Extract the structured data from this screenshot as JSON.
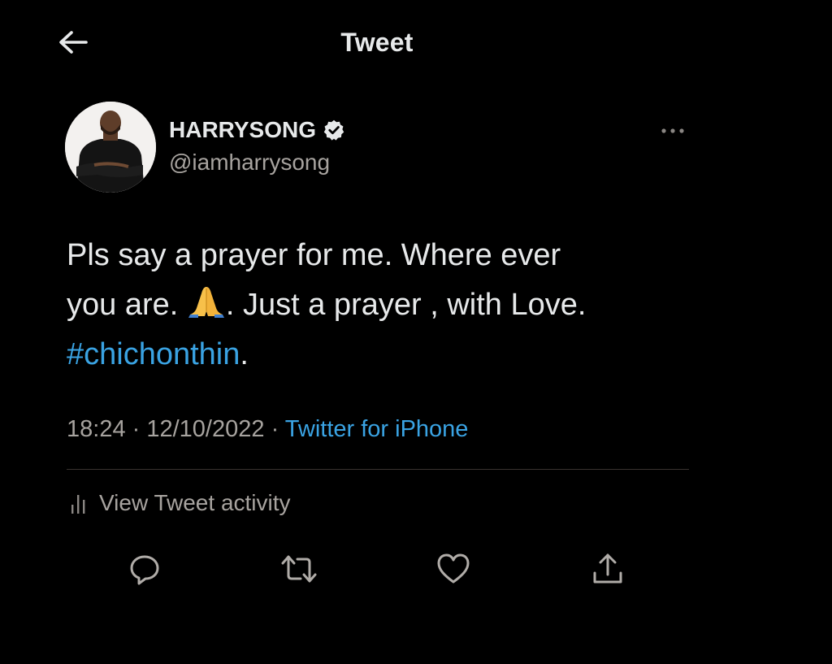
{
  "header": {
    "title": "Tweet",
    "back_icon": "arrow-left-icon"
  },
  "author": {
    "display_name": "HARRYSONG",
    "handle": "@iamharrysong",
    "verified_icon": "verified-badge-icon",
    "more_icon": "more-horizontal-icon"
  },
  "tweet": {
    "text_line1": "Pls say a prayer for me. Where ever",
    "text_line2_before": "you are. ",
    "emoji": "folded-hands-emoji",
    "text_line2_after": ". Just a prayer , with Love.",
    "hashtag": "#chichonthin",
    "hashtag_trailing": "."
  },
  "meta": {
    "time": "18:24",
    "separator": " · ",
    "date": "12/10/2022",
    "source": "Twitter for iPhone"
  },
  "activity": {
    "label": "View Tweet activity",
    "icon": "bar-chart-icon"
  },
  "actions": [
    {
      "name": "reply",
      "icon": "reply-icon"
    },
    {
      "name": "retweet",
      "icon": "retweet-icon"
    },
    {
      "name": "like",
      "icon": "heart-icon"
    },
    {
      "name": "share",
      "icon": "share-icon"
    }
  ],
  "colors": {
    "background": "#000000",
    "text": "#e7e9ea",
    "secondary": "#a7a39f",
    "link": "#3aa3e3"
  }
}
